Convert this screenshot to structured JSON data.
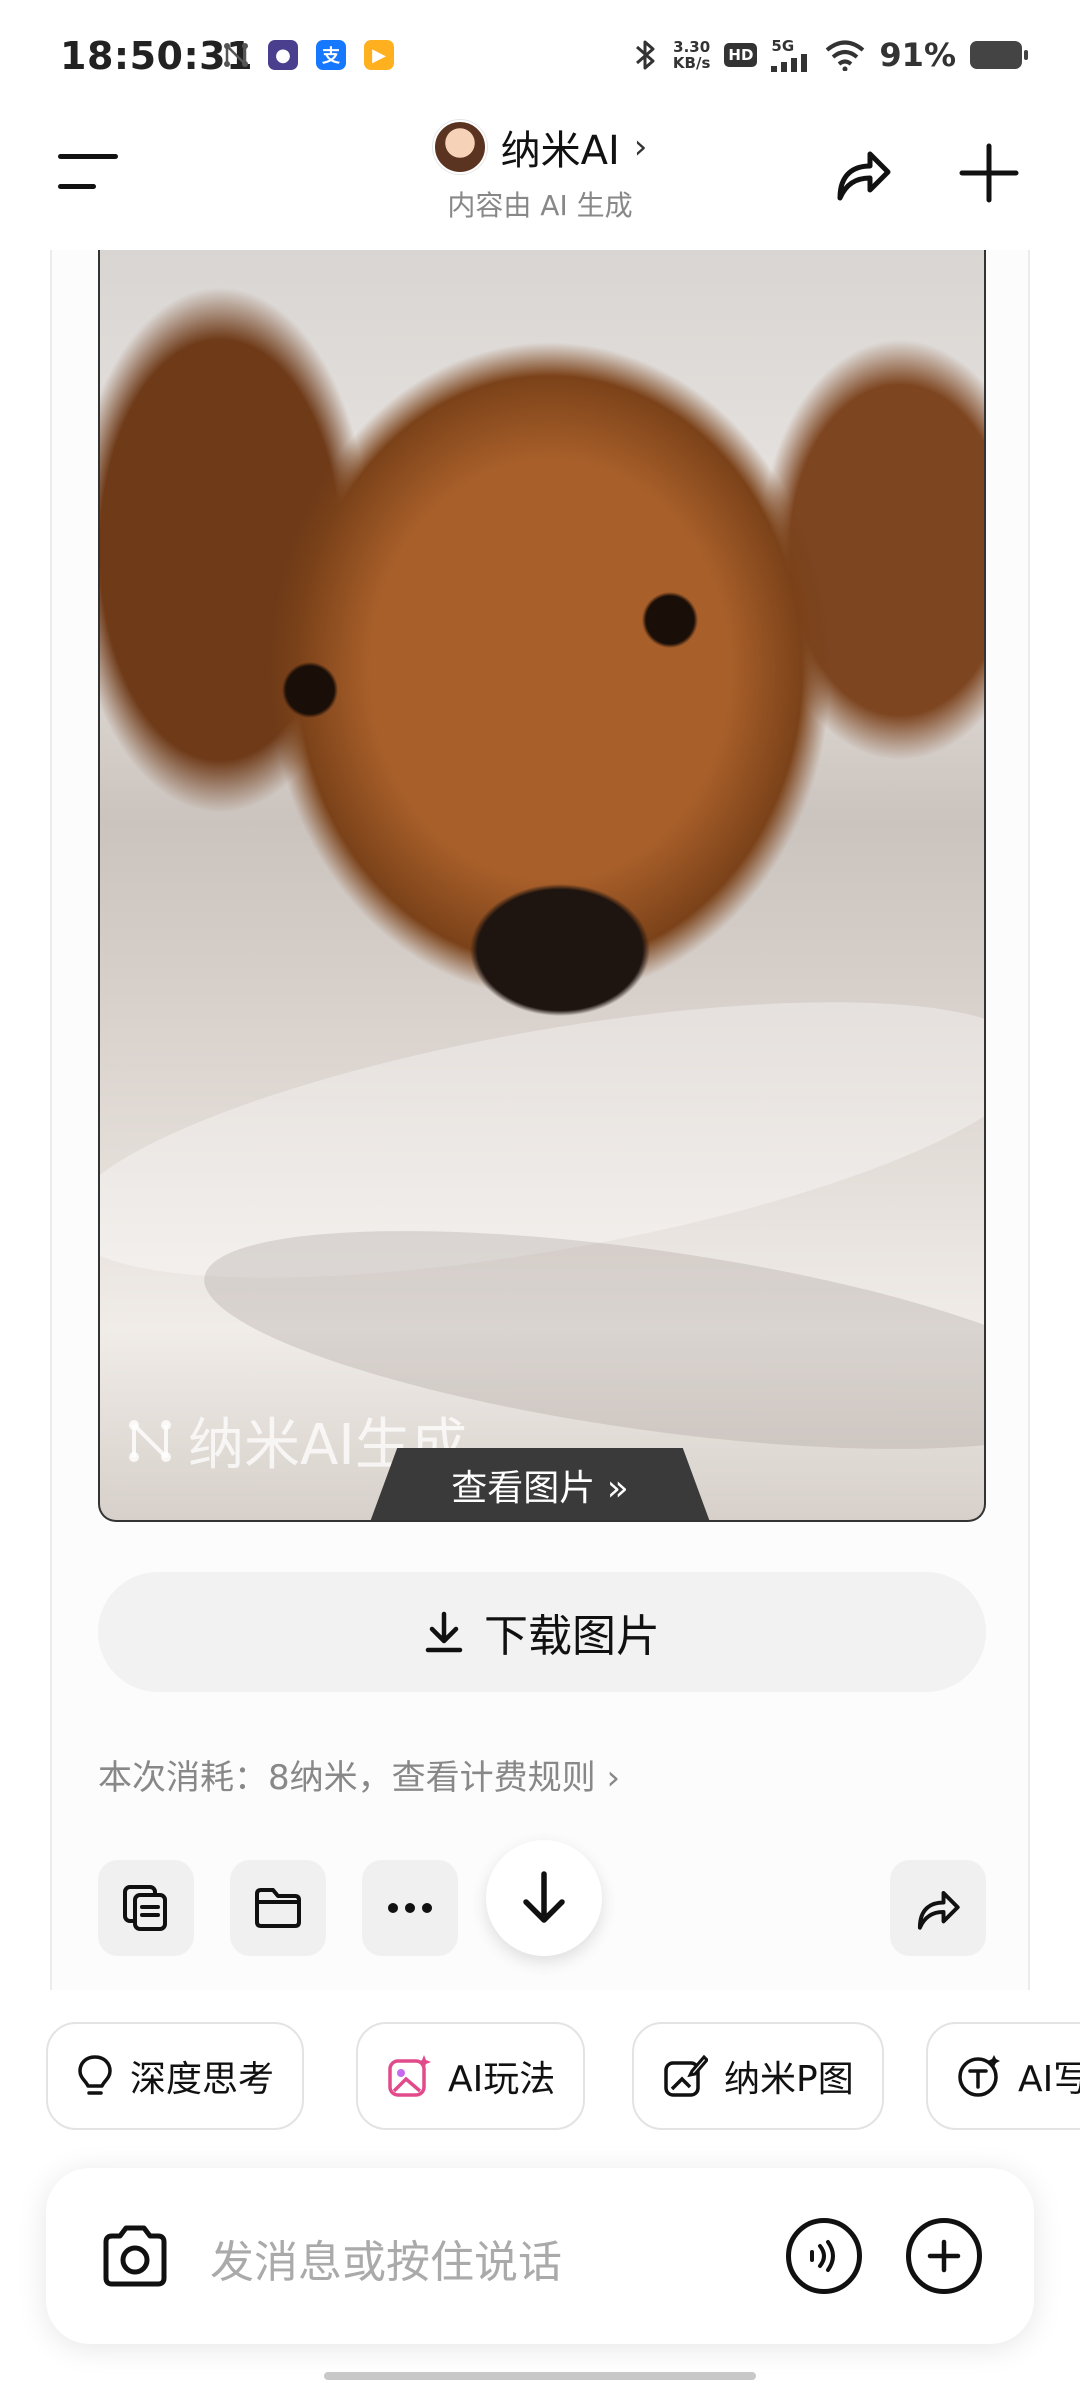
{
  "status_bar": {
    "time": "18:50:31",
    "net_speed_value": "3.30",
    "net_speed_unit": "KB/s",
    "hd": "HD",
    "signal": "5G",
    "battery": "91%"
  },
  "header": {
    "title": "纳米AI",
    "subtitle": "内容由 AI 生成"
  },
  "image_card": {
    "watermark": "纳米AI生成",
    "view_image": "查看图片 »",
    "download_label": "下载图片",
    "cost_text": "本次消耗：8纳米，查看计费规则",
    "cost_chevron": "›"
  },
  "chips": [
    {
      "label": "深度思考",
      "icon": "lightbulb-icon"
    },
    {
      "label": "AI玩法",
      "icon": "sparkle-image-icon"
    },
    {
      "label": "纳米P图",
      "icon": "edit-image-icon"
    },
    {
      "label": "AI写",
      "icon": "ai-write-icon"
    }
  ],
  "input": {
    "placeholder": "发消息或按住说话"
  },
  "colors": {
    "accent_pink": "#e14b8b",
    "text_primary": "#111111",
    "text_secondary": "#888888"
  }
}
